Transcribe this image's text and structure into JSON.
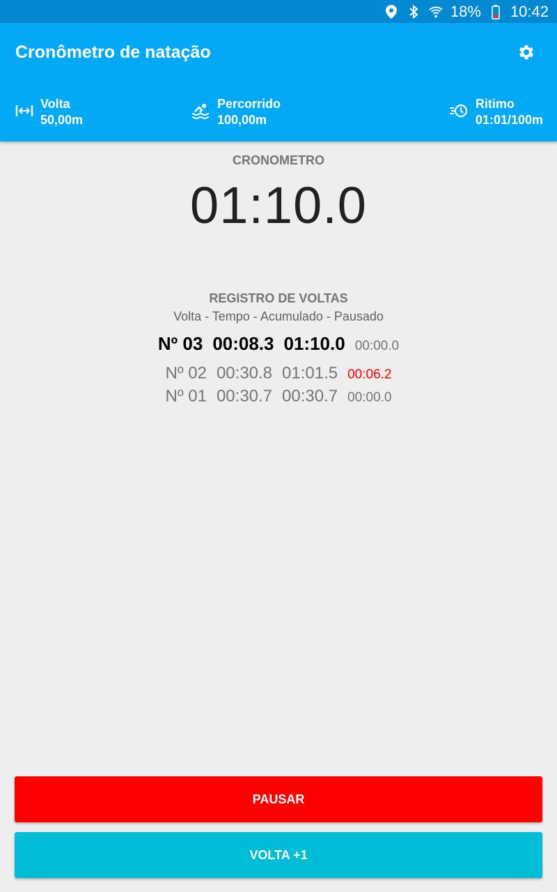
{
  "status_bar": {
    "battery": "18%",
    "time": "10:42",
    "icons": [
      "location-icon",
      "bluetooth-icon",
      "wifi-icon",
      "battery-icon"
    ]
  },
  "app_bar": {
    "title": "Cronômetro de natação",
    "settings_icon": "gear-icon",
    "stats": {
      "volta": {
        "label": "Volta",
        "value": "50,00m",
        "icon": "lap-length-icon"
      },
      "percorrido": {
        "label": "Percorrido",
        "value": "100,00m",
        "icon": "swimmer-icon"
      },
      "ritimo": {
        "label": "Ritimo",
        "value": "01:01/100m",
        "icon": "pace-clock-icon"
      }
    }
  },
  "stopwatch": {
    "label": "CRONOMETRO",
    "time": "01:10.0"
  },
  "laps": {
    "title": "REGISTRO DE VOLTAS",
    "columns_hint": "Volta - Tempo - Acumulado - Pausado",
    "current": {
      "number": "Nº 03",
      "time": "00:08.3",
      "total": "01:10.0",
      "paused": "00:00.0"
    },
    "history": [
      {
        "number": "Nº 02",
        "time": "00:30.8",
        "total": "01:01.5",
        "paused": "00:06.2",
        "paused_alert": true
      },
      {
        "number": "Nº 01",
        "time": "00:30.7",
        "total": "00:30.7",
        "paused": "00:00.0",
        "paused_alert": false
      }
    ]
  },
  "actions": {
    "pause_label": "PAUSAR",
    "lap_label": "VOLTA +1"
  },
  "colors": {
    "status_bar": "#0289d1",
    "app_bar": "#03a9f4",
    "pause_button": "#ff0000",
    "lap_button": "#00bcd4",
    "paused_alert": "#ff0000"
  }
}
